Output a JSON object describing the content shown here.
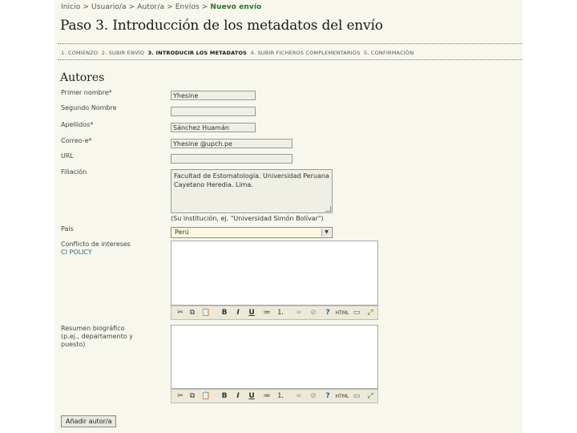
{
  "breadcrumb": {
    "items": [
      "Inicio",
      "Usuario/a",
      "Autor/a",
      "Envíos"
    ],
    "separator": ">",
    "current": "Nuevo envío"
  },
  "page_title": "Paso 3. Introducción de los metadatos del envío",
  "steps": [
    "1. COMIENZO",
    "2. SUBIR ENVÍO",
    "3. INTRODUCIR LOS METADATOS",
    "4. SUBIR FICHEROS COMPLEMENTARIOS",
    "5. CONFIRMACIÓN"
  ],
  "active_step": 2,
  "section_title": "Autores",
  "form": {
    "first_name_label": "Primer nombre*",
    "first_name_value": "Yhesine",
    "middle_name_label": "Segundo Nombre",
    "middle_name_value": "",
    "last_name_label": "Apellidos*",
    "last_name_value": "Sánchez Huamán",
    "email_label": "Correo-e*",
    "email_value": "Yhesine @upch.pe",
    "url_label": "URL",
    "url_value": "",
    "affiliation_label": "Filiación",
    "affiliation_value": "Facultad de Estomatología. Universidad Peruana Cayetano Heredia. Lima.",
    "affiliation_hint": "(Su institución, ej. \"Universidad Simón Bolívar\")",
    "country_label": "País",
    "country_value": "Perú",
    "conflict_label": "Conflicto de intereses",
    "conflict_link": "CI POLICY",
    "bio_label_lines": [
      "Resumen biográfico",
      "(p.ej., departamento y",
      "puesto)"
    ],
    "toolbar": {
      "cut_icon": "✂",
      "copy_icon": "⧉",
      "paste_icon": "📋",
      "bold": "B",
      "italic": "I",
      "underline": "U",
      "bullets_icon": "≔",
      "numbers_icon": "⒈",
      "link_icon": "∞",
      "unlink_icon": "⊘",
      "help_icon": "?",
      "html": "HTML",
      "image_icon": "▭",
      "fullscreen_icon": "⤢"
    },
    "add_author_button": "Añadir autor/a"
  },
  "colors": {
    "page_bg": "#f7f7ee",
    "breadcrumb_current": "#2e6e2e",
    "select_bg": "#fff8e0",
    "policy_link": "#2d6b7a"
  }
}
